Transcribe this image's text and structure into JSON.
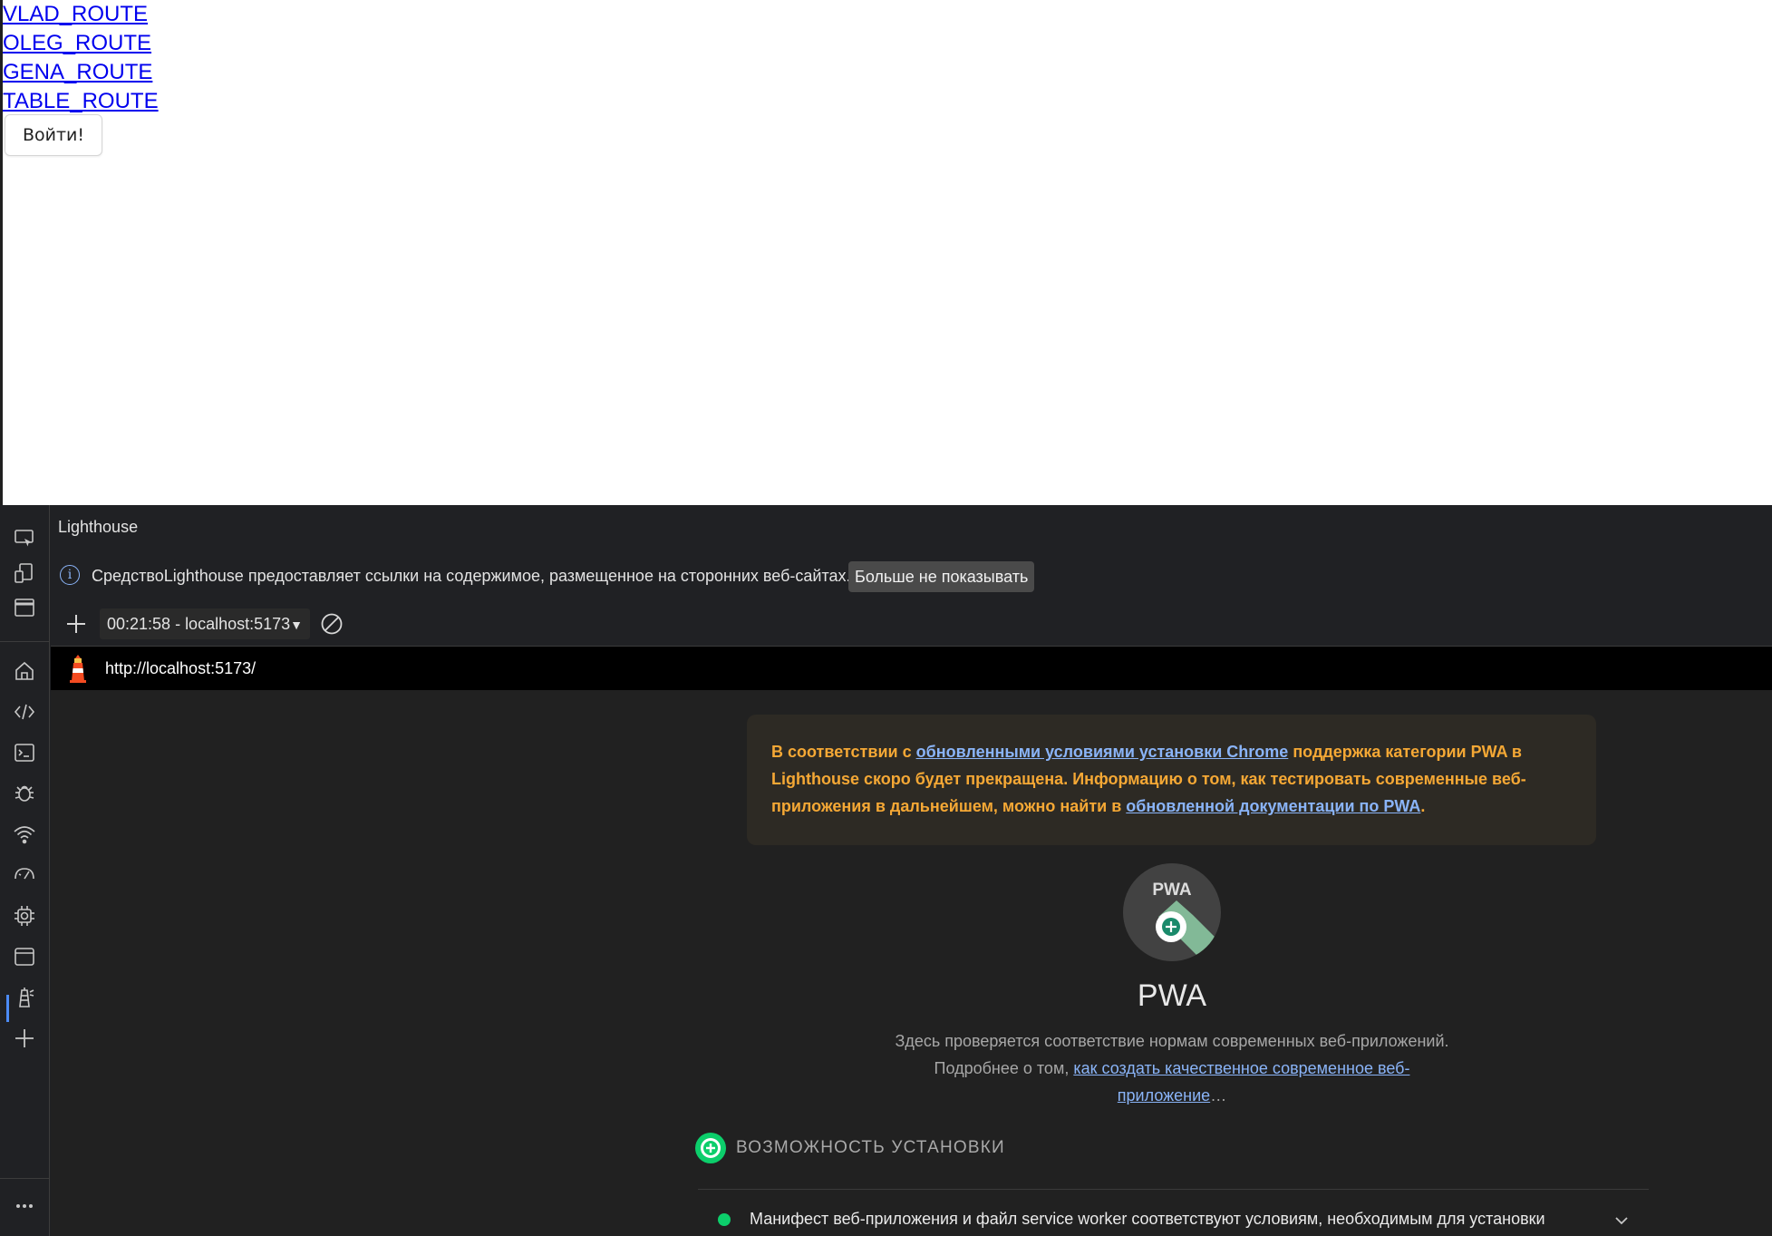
{
  "page": {
    "links": [
      "VLAD_ROUTE",
      "OLEG_ROUTE",
      "GENA_ROUTE",
      "TABLE_ROUTE"
    ],
    "login_button": "Войти!"
  },
  "devtools": {
    "activity_icons": [
      "inspect-icon",
      "device-toolbar-icon",
      "dock-icon",
      "home-icon",
      "elements-icon",
      "console-icon",
      "sources-debug-icon",
      "network-icon",
      "performance-icon",
      "memory-icon",
      "application-icon",
      "lighthouse-icon",
      "add-tool-icon",
      "more-icon"
    ],
    "tab_title": "Lighthouse",
    "info": {
      "text": "СредствоLighthouse предоставляет ссылки на содержимое, размещенное на сторонних веб-сайтах.",
      "dismiss": "Больше не показывать"
    },
    "toolbar": {
      "report_selector": "00:21:58 - localhost:5173"
    },
    "report_url": "http://localhost:5173/",
    "warning": {
      "part1": "В соответствии с ",
      "link1": "обновленными условиями установки Chrome",
      "part2": " поддержка категории PWA в Lighthouse скоро будет прекращена. Информацию о том, как тестировать современные веб-приложения в дальнейшем, можно найти в ",
      "link2": "обновленной документации по PWA",
      "part3": "."
    },
    "pwa": {
      "badge": "PWA",
      "title": "PWA",
      "desc_part1": "Здесь проверяется соответствие нормам современных веб-приложений. Подробнее о том, ",
      "desc_link": "как создать качественное современное веб-приложение",
      "desc_part2": "…"
    },
    "installable": {
      "label": "ВОЗМОЖНОСТЬ УСТАНОВКИ",
      "audit": "Манифест веб-приложения и файл service worker соответствуют условиям, необходимым для установки",
      "status_color": "#0cce6b"
    },
    "colors": {
      "warning_text": "#f5a835",
      "link": "#8ab4f8",
      "accent": "#4c8bf5"
    }
  }
}
